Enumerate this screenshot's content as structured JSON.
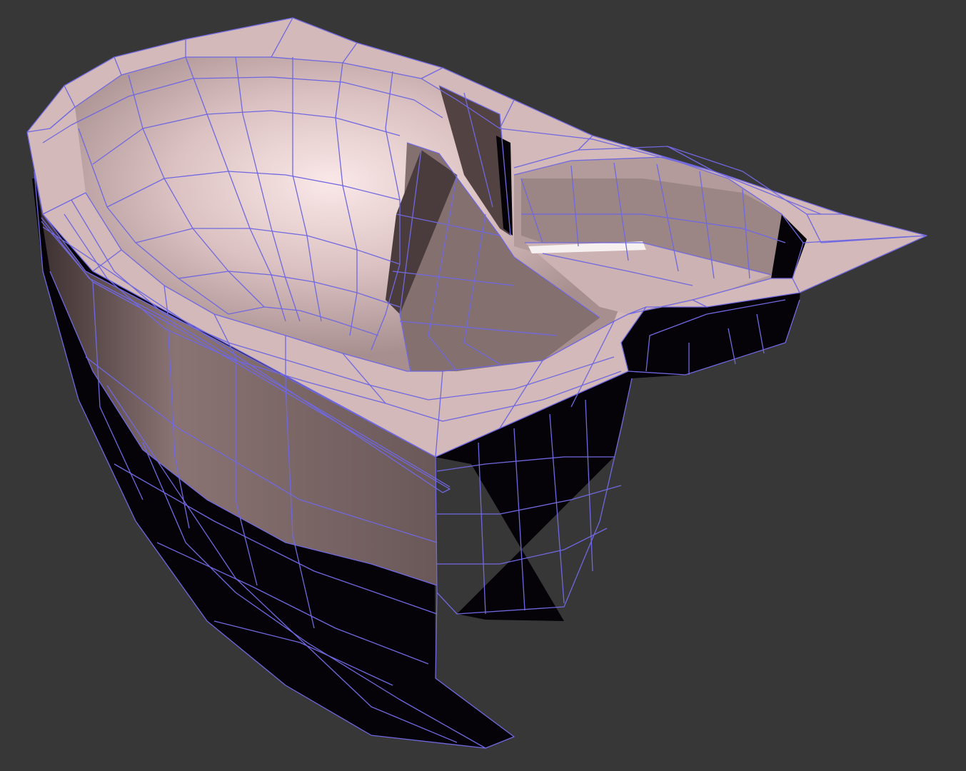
{
  "viewport": {
    "background": "#373737",
    "wire_color": "#7068e0",
    "surface_light": "#cdb3b3",
    "surface_highlight": "#f2dede",
    "surface_mid": "#9c8585",
    "surface_dark": "#5a4a4a",
    "backface": "#050308"
  },
  "model": {
    "icon": "bathtub-mesh-icon"
  }
}
